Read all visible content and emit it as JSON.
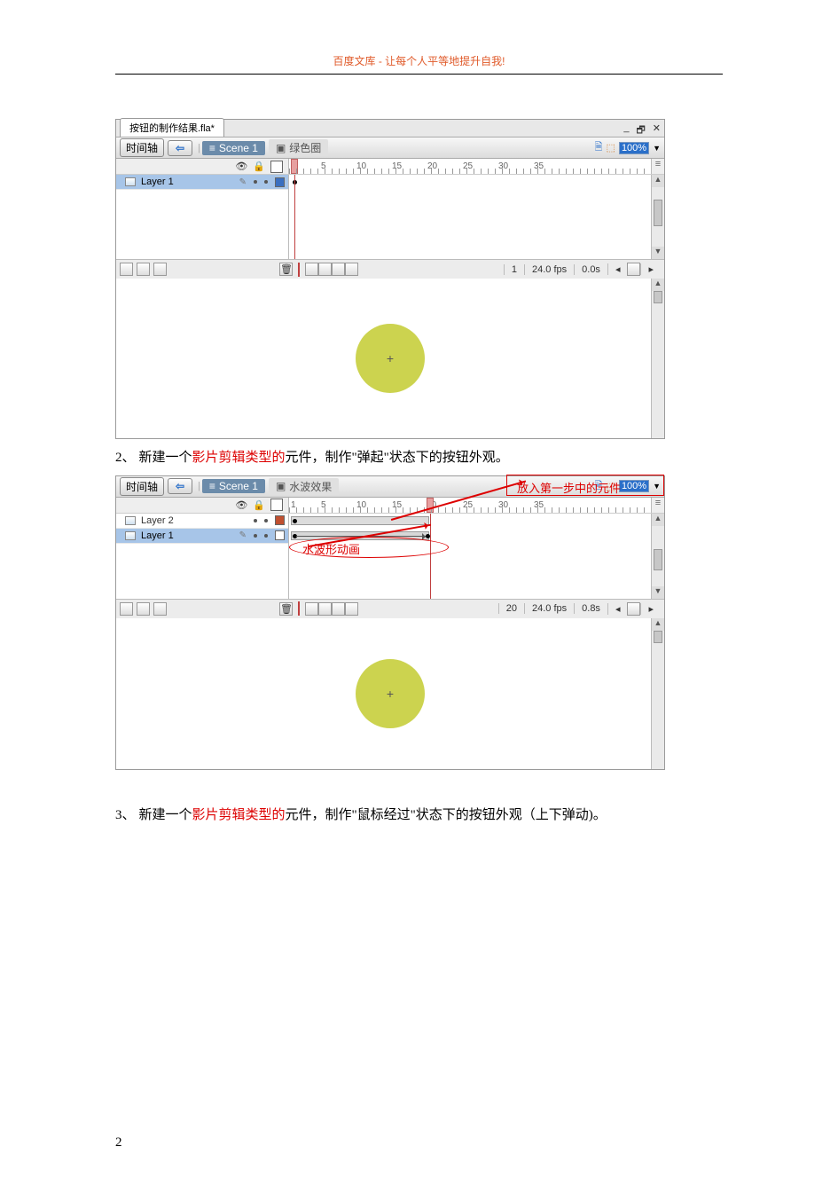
{
  "header": "百度文库 - 让每个人平等地提升自我!",
  "fig1": {
    "doc_tab": "按钮的制作结果.fla*",
    "timeline_btn": "时间轴",
    "scene": "Scene 1",
    "symbol": "绿色圈",
    "zoom": "100%",
    "ticks": [
      "5",
      "10",
      "15",
      "20",
      "25",
      "30",
      "35"
    ],
    "layer1": "Layer 1",
    "status_frame": "1",
    "status_fps": "24.0 fps",
    "status_time": "0.0s",
    "cross": "+"
  },
  "para2": {
    "num": "2、",
    "t1": "新建一个",
    "red": "影片剪辑类型的",
    "t2": "元件，制作\"弹起\"状态下的按钮外观。"
  },
  "fig2": {
    "timeline_btn": "时间轴",
    "scene": "Scene 1",
    "symbol": "水波效果",
    "zoom": "100%",
    "ticks": [
      "1",
      "5",
      "10",
      "15",
      "20",
      "25",
      "30",
      "35"
    ],
    "layer2": "Layer 2",
    "layer1": "Layer 1",
    "status_frame": "20",
    "status_fps": "24.0 fps",
    "status_time": "0.8s",
    "cross": "+",
    "annot_right": "放入第一步中的元件",
    "annot_wave": "水波形动画"
  },
  "para3": {
    "num": "3、",
    "t1": "新建一个",
    "red": "影片剪辑类型的",
    "t2": "元件，制作\"鼠标经过\"状态下的按钮外观（上下弹动)。"
  },
  "page_num": "2"
}
